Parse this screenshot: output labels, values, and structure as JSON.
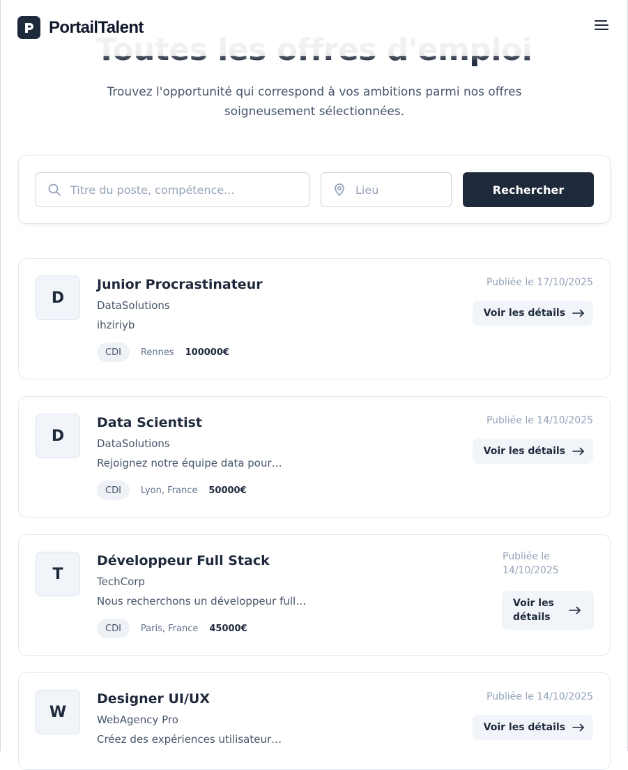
{
  "header": {
    "brand": "PortailTalent",
    "logo_letter": "P"
  },
  "hero": {
    "title": "Toutes les offres d'emploi",
    "subtitle": "Trouvez l'opportunité qui correspond à vos ambitions parmi nos offres soigneusement sélectionnées."
  },
  "search": {
    "title_placeholder": "Titre du poste, compétence...",
    "location_placeholder": "Lieu",
    "button_label": "Rechercher"
  },
  "jobs": [
    {
      "initial": "D",
      "title": "Junior Procrastinateur",
      "company": "DataSolutions",
      "description": "ihziriyb",
      "type": "CDI",
      "location": "Rennes",
      "salary": "100000€",
      "date": "Publiée le 17/10/2025",
      "details_label": "Voir les détails"
    },
    {
      "initial": "D",
      "title": "Data Scientist",
      "company": "DataSolutions",
      "description": "Rejoignez notre équipe data pour…",
      "type": "CDI",
      "location": "Lyon, France",
      "salary": "50000€",
      "date": "Publiée le 14/10/2025",
      "details_label": "Voir les détails"
    },
    {
      "initial": "T",
      "title": "Développeur Full Stack",
      "company": "TechCorp",
      "description": "Nous recherchons un développeur full…",
      "type": "CDI",
      "location": "Paris, France",
      "salary": "45000€",
      "date": "Publiée le 14/10/2025",
      "details_label": "Voir les détails"
    },
    {
      "initial": "W",
      "title": "Designer UI/UX",
      "company": "WebAgency Pro",
      "description": "Créez des expériences utilisateur…",
      "date": "Publiée le 14/10/2025",
      "details_label": "Voir les détails"
    }
  ],
  "colors": {
    "primary": "#1e293b",
    "muted": "#94a3b8",
    "border": "#e2e8f0",
    "chip": "#f1f5f9"
  }
}
